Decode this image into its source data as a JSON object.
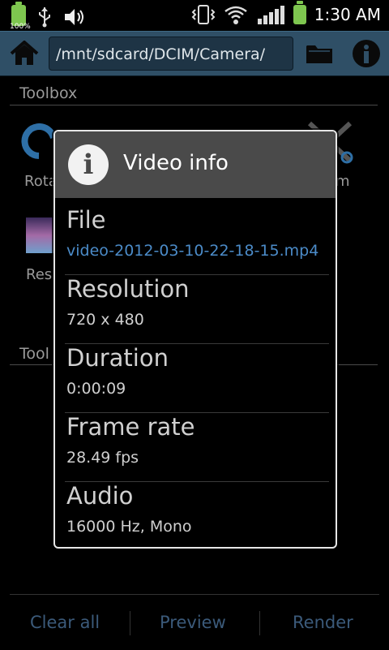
{
  "status_bar": {
    "battery_percent": "100%",
    "time": "1:30 AM"
  },
  "toolbar": {
    "path": "/mnt/sdcard/DCIM/Camera/"
  },
  "background": {
    "section1_title": "Toolbox",
    "item_rotate": "Rota",
    "item_zoom": "m",
    "item_res": "Res",
    "section2_title": "Tool"
  },
  "bottom_bar": {
    "clear_all": "Clear all",
    "preview": "Preview",
    "render": "Render"
  },
  "dialog": {
    "title": "Video info",
    "rows": [
      {
        "label": "File",
        "value": "video-2012-03-10-22-18-15.mp4"
      },
      {
        "label": "Resolution",
        "value": "720 x 480"
      },
      {
        "label": "Duration",
        "value": "0:00:09"
      },
      {
        "label": "Frame rate",
        "value": "28.49 fps"
      },
      {
        "label": "Audio",
        "value": "16000 Hz, Mono"
      }
    ]
  },
  "colors": {
    "toolbar": "#2f4f66",
    "link": "#4b8bc8",
    "battery": "#7ec64f"
  }
}
